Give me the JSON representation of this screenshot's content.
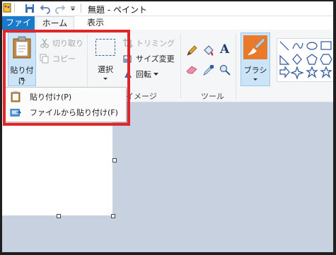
{
  "title_bar": {
    "title": "無題 - ペイント",
    "quick_access": [
      "save-icon",
      "undo-icon",
      "redo-icon",
      "customize-icon"
    ]
  },
  "tabs": [
    {
      "label": "ファイル",
      "active": false,
      "style": "blue"
    },
    {
      "label": "ホーム",
      "active": true
    },
    {
      "label": "表示",
      "active": false
    }
  ],
  "clipboard": {
    "paste_label": "貼り付け",
    "cut_label": "切り取り",
    "copy_label": "コピー"
  },
  "image_group": {
    "select_label": "選択",
    "crop_label": "トリミング",
    "resize_label": "サイズ変更",
    "rotate_label": "回転",
    "group_label": "イメージ"
  },
  "tools_group": {
    "group_label": "ツール",
    "tools": [
      "pencil-icon",
      "fill-icon",
      "text-icon",
      "eraser-icon",
      "color-picker-icon",
      "magnifier-icon"
    ]
  },
  "brush": {
    "label": "ブラシ"
  },
  "shapes": [
    "line",
    "curve",
    "oval",
    "rectangle",
    "rounded-rectangle",
    "triangle",
    "diamond",
    "pentagon",
    "hexagon",
    "arrow",
    "star4",
    "star5"
  ],
  "paste_menu": {
    "items": [
      {
        "label": "貼り付け(P)",
        "accel": "P"
      },
      {
        "label": "ファイルから貼り付け(F)",
        "accel": "F"
      }
    ]
  },
  "colors": {
    "file_tab": "#1979ca",
    "highlight": "#e0252b",
    "canvas_bg": "#c8d1e0",
    "selected_button": "#cce4f7"
  }
}
